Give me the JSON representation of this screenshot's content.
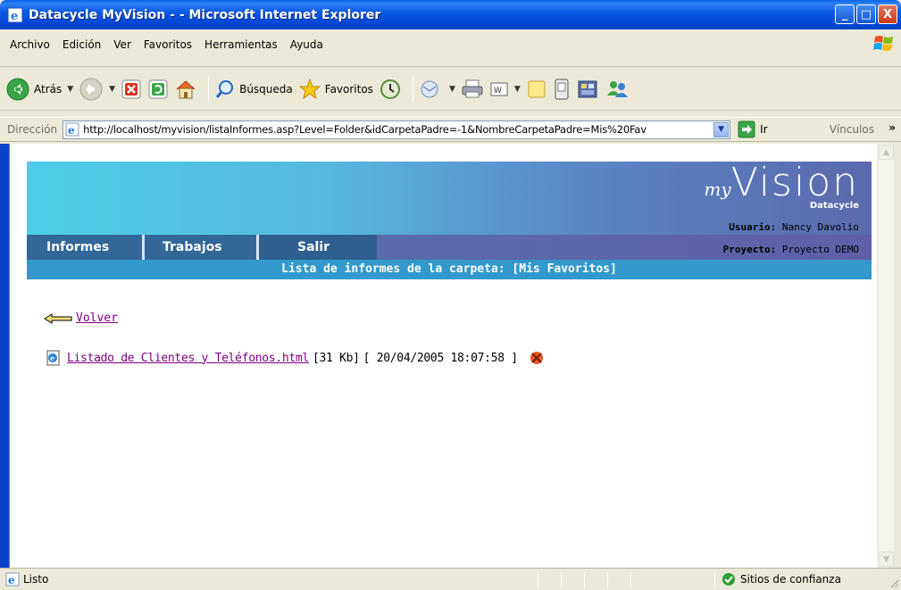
{
  "window": {
    "title": "Datacycle MyVision - - Microsoft Internet Explorer",
    "minimize": "_",
    "maximize": "□",
    "close": "X"
  },
  "menu": [
    "Archivo",
    "Edición",
    "Ver",
    "Favoritos",
    "Herramientas",
    "Ayuda"
  ],
  "toolbar": {
    "back_label": "Atrás",
    "search_label": "Búsqueda",
    "favorites_label": "Favoritos"
  },
  "address": {
    "label": "Dirección",
    "url": "http://localhost/myvision/listaInformes.asp?Level=Folder&idCarpetaPadre=-1&NombreCarpetaPadre=Mis%20Fav",
    "go_label": "Ir",
    "links_label": "Vínculos"
  },
  "page": {
    "logo_my": "my",
    "logo_vision": "Vision",
    "logo_brand": "Datacycle",
    "user_label": "Usuario:",
    "user_name": "Nancy Davolio",
    "project_label": "Proyecto:",
    "project_name": "Proyecto DEMO",
    "nav": [
      "Informes",
      "Trabajos",
      "Salir"
    ],
    "subtitle": "Lista de informes de la carpeta: [Mis Favoritos]",
    "back_link": "Volver",
    "files": [
      {
        "name": "Listado de Clientes y Teléfonos.html",
        "size": "[31 Kb]",
        "date": "[ 20/04/2005 18:07:58 ]"
      }
    ]
  },
  "status": {
    "text": "Listo",
    "zone": "Sitios de confianza"
  },
  "colors": {
    "titlebar": "#0a5fe8",
    "nav_tab": "#336699",
    "subtitle_bar": "#3399cc",
    "visited_link": "#800080"
  }
}
